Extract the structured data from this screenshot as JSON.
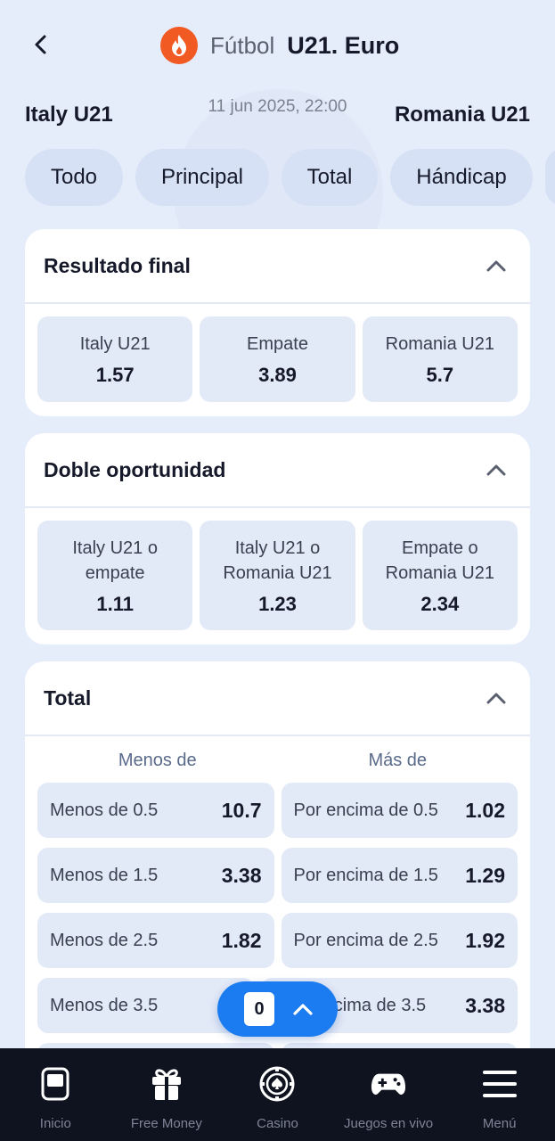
{
  "header": {
    "sport": "Fútbol",
    "league": "U21. Euro",
    "sport_icon": "flame-icon"
  },
  "match": {
    "home": "Italy U21",
    "away": "Romania U21",
    "datetime": "11 jun 2025, 22:00"
  },
  "tabs": [
    {
      "label": "Todo"
    },
    {
      "label": "Principal"
    },
    {
      "label": "Total"
    },
    {
      "label": "Hándicap"
    }
  ],
  "markets": {
    "resultado": {
      "title": "Resultado final",
      "outcomes": [
        {
          "label": "Italy U21",
          "odd": "1.57"
        },
        {
          "label": "Empate",
          "odd": "3.89"
        },
        {
          "label": "Romania U21",
          "odd": "5.7"
        }
      ]
    },
    "doble": {
      "title": "Doble oportunidad",
      "outcomes": [
        {
          "line1": "Italy U21 o",
          "line2": "empate",
          "odd": "1.11"
        },
        {
          "line1": "Italy U21 o",
          "line2": "Romania U21",
          "odd": "1.23"
        },
        {
          "line1": "Empate o",
          "line2": "Romania U21",
          "odd": "2.34"
        }
      ]
    },
    "total": {
      "title": "Total",
      "col_under": "Menos de",
      "col_over": "Más de",
      "rows": [
        {
          "under_label": "Menos de 0.5",
          "under_odd": "10.7",
          "over_label": "Por encima de 0.5",
          "over_odd": "1.02"
        },
        {
          "under_label": "Menos de 1.5",
          "under_odd": "3.38",
          "over_label": "Por encima de 1.5",
          "over_odd": "1.29"
        },
        {
          "under_label": "Menos de 2.5",
          "under_odd": "1.82",
          "over_label": "Por encima de 2.5",
          "over_odd": "1.92"
        },
        {
          "under_label": "Menos de 3.5",
          "under_odd": "",
          "over_label": "encima de 3.5",
          "over_odd": "3.38"
        }
      ]
    }
  },
  "betslip": {
    "count": "0"
  },
  "nav": [
    {
      "label": "Inicio",
      "icon": "home-icon"
    },
    {
      "label": "Free Money",
      "icon": "gift-icon"
    },
    {
      "label": "Casino",
      "icon": "casino-chip-icon"
    },
    {
      "label": "Juegos en vivo",
      "icon": "gamepad-icon"
    },
    {
      "label": "Menú",
      "icon": "menu-icon"
    }
  ],
  "colors": {
    "accent": "#1a7cf0",
    "flame": "#f25a24",
    "nav_bg": "#0f1320",
    "page_bg": "#e6edfa"
  }
}
